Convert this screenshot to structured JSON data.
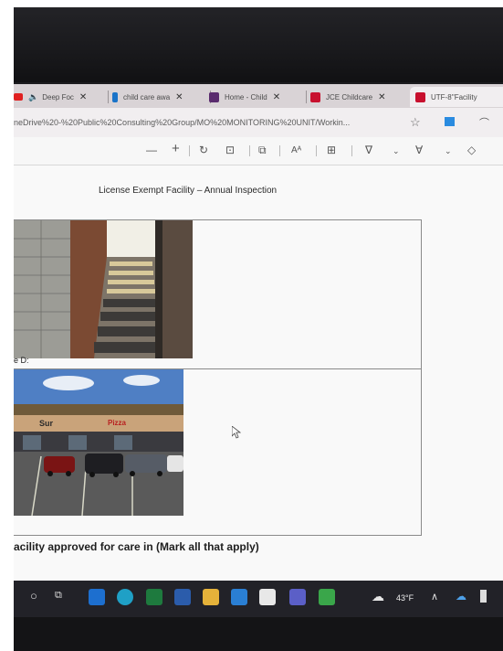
{
  "browser": {
    "tabs": [
      {
        "label": "Deep Foc",
        "icon": "youtube-icon"
      },
      {
        "label": "child care awa",
        "icon": "bing-icon"
      },
      {
        "label": "Home - Child",
        "icon": "site-icon"
      },
      {
        "label": "JCE Childcare",
        "icon": "pdf-icon"
      },
      {
        "label": "UTF-8''Facility",
        "icon": "pdf-icon"
      }
    ],
    "close_glyph": "✕",
    "address": "neDrive%20-%20Public%20Consulting%20Group/MO%20MONITORING%20UNIT/Workin..."
  },
  "pdf_toolbar": {
    "zoom_out": "—",
    "zoom_in": "+",
    "read_aloud": "Aᴬ"
  },
  "document": {
    "title": "License Exempt Facility – Annual Inspection",
    "label_d": "e D:",
    "section_heading": "acility approved for care in (Mark all that apply)",
    "storefront_sign_1": "Sur",
    "storefront_sign_2": "Pizza"
  },
  "taskbar": {
    "weather_temp": "43°F"
  },
  "colors": {
    "tab_bar": "#d9d3d6",
    "taskbar": "#222228",
    "screen_bg": "#f4f4f4",
    "pdf_red": "#c8102e"
  }
}
